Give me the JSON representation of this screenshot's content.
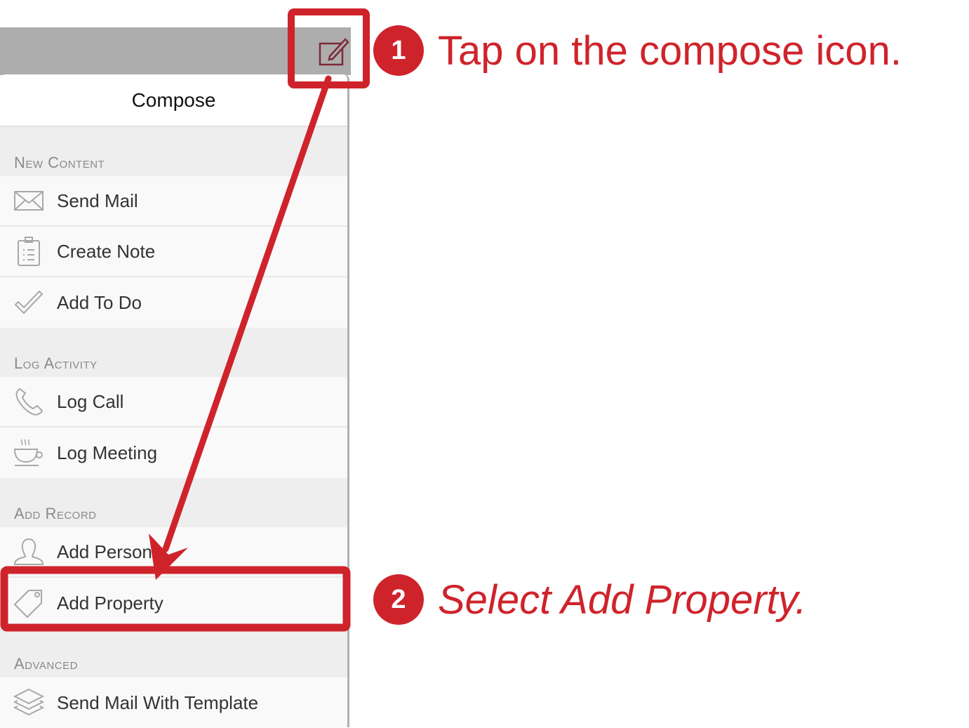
{
  "panel": {
    "title": "Compose",
    "sections": [
      {
        "header": "New Content",
        "items": [
          {
            "label": "Send Mail",
            "icon": "envelope-icon"
          },
          {
            "label": "Create Note",
            "icon": "clipboard-icon"
          },
          {
            "label": "Add To Do",
            "icon": "checkmark-icon"
          }
        ]
      },
      {
        "header": "Log Activity",
        "items": [
          {
            "label": "Log Call",
            "icon": "phone-icon"
          },
          {
            "label": "Log Meeting",
            "icon": "coffee-cup-icon"
          }
        ]
      },
      {
        "header": "Add Record",
        "items": [
          {
            "label": "Add Person",
            "icon": "person-icon"
          },
          {
            "label": "Add Property",
            "icon": "tag-icon"
          }
        ]
      },
      {
        "header": "Advanced",
        "items": [
          {
            "label": "Send Mail With Template",
            "icon": "layers-icon"
          }
        ]
      }
    ]
  },
  "toolbar": {
    "compose_icon": "compose-icon"
  },
  "annotations": {
    "step1": {
      "number": "1",
      "text": "Tap on the compose icon."
    },
    "step2": {
      "number": "2",
      "text": "Select Add Property."
    },
    "accent_color": "#cf232b"
  }
}
